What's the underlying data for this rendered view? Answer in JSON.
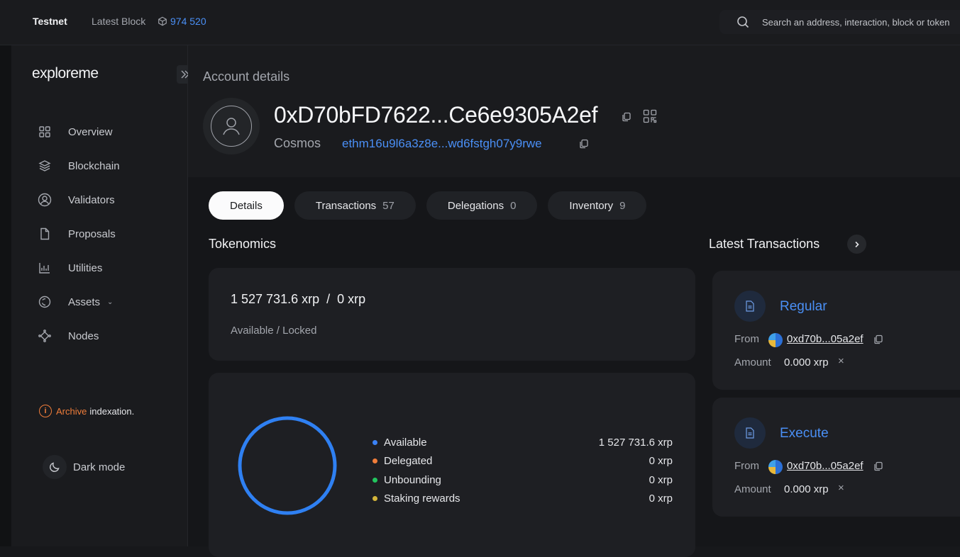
{
  "topbar": {
    "network": "Testnet",
    "latest_block_label": "Latest Block",
    "latest_block_number": "974 520",
    "search_placeholder": "Search an address, interaction, block or token"
  },
  "sidebar": {
    "logo": "exploreme",
    "items": [
      {
        "label": "Overview",
        "icon": "grid-icon"
      },
      {
        "label": "Blockchain",
        "icon": "layers-icon"
      },
      {
        "label": "Validators",
        "icon": "user-circle-icon"
      },
      {
        "label": "Proposals",
        "icon": "document-icon"
      },
      {
        "label": "Utilities",
        "icon": "chart-icon"
      },
      {
        "label": "Assets",
        "icon": "coin-icon"
      },
      {
        "label": "Nodes",
        "icon": "nodes-icon"
      }
    ],
    "archive_word": "Archive",
    "archive_rest": "indexation.",
    "dark_mode_label": "Dark mode"
  },
  "account": {
    "title": "Account details",
    "address": "0xD70bFD7622...Ce6e9305A2ef",
    "cosmos_label": "Cosmos",
    "cosmos_address": "ethm16u9l6a3z8e...wd6fstgh07y9rwe"
  },
  "tabs": [
    {
      "label": "Details",
      "count": ""
    },
    {
      "label": "Transactions",
      "count": "57"
    },
    {
      "label": "Delegations",
      "count": "0"
    },
    {
      "label": "Inventory",
      "count": "9"
    }
  ],
  "tokenomics": {
    "title": "Tokenomics",
    "available": "1 527 731.6 xrp",
    "separator": "/",
    "locked": "0 xrp",
    "sub": "Available / Locked",
    "legend": [
      {
        "label": "Available",
        "amount": "1 527 731.6 xrp",
        "color": "#3b82f6"
      },
      {
        "label": "Delegated",
        "amount": "0 xrp",
        "color": "#f07d3a"
      },
      {
        "label": "Unbounding",
        "amount": "0 xrp",
        "color": "#22c55e"
      },
      {
        "label": "Staking rewards",
        "amount": "0 xrp",
        "color": "#d4b53a"
      }
    ]
  },
  "latest_transactions": {
    "title": "Latest Transactions",
    "items": [
      {
        "type": "Regular",
        "from_label": "From",
        "from": "0xd70b...05a2ef",
        "amount_label": "Amount",
        "amount": "0.000 xrp",
        "x": "×"
      },
      {
        "type": "Execute",
        "from_label": "From",
        "from": "0xd70b...05a2ef",
        "amount_label": "Amount",
        "amount": "0.000 xrp",
        "x": "×"
      }
    ]
  }
}
